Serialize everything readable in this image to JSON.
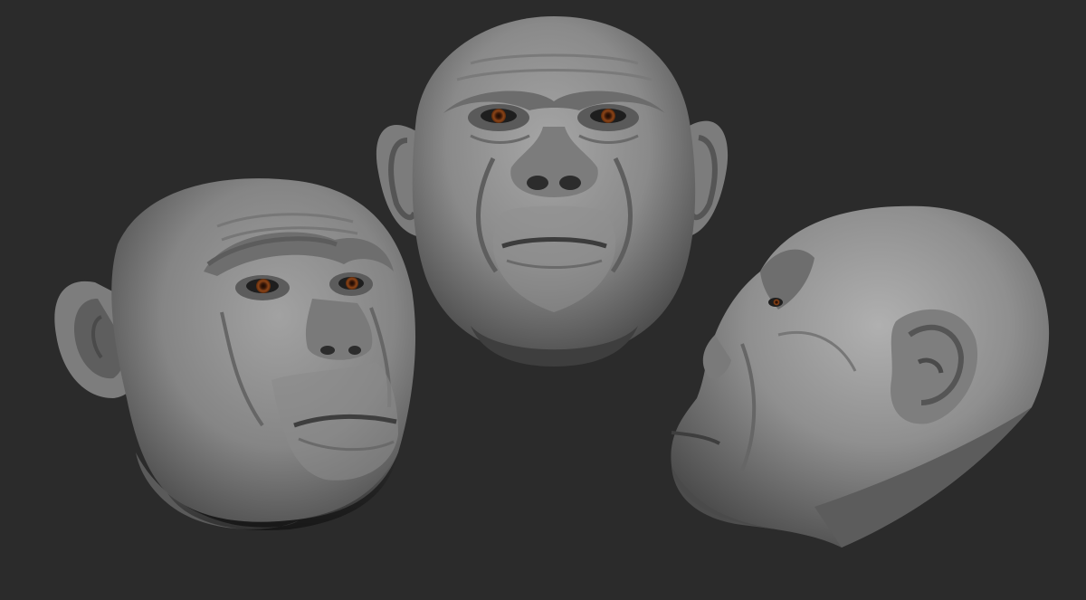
{
  "scene": {
    "background_color": "#2b2b2b",
    "skin_color": "#8e8e8e",
    "iris_color": "#7a3a12",
    "views": [
      {
        "id": "three-quarter-left",
        "view": "three-quarter"
      },
      {
        "id": "front",
        "view": "front"
      },
      {
        "id": "profile-right",
        "view": "side profile"
      }
    ]
  }
}
